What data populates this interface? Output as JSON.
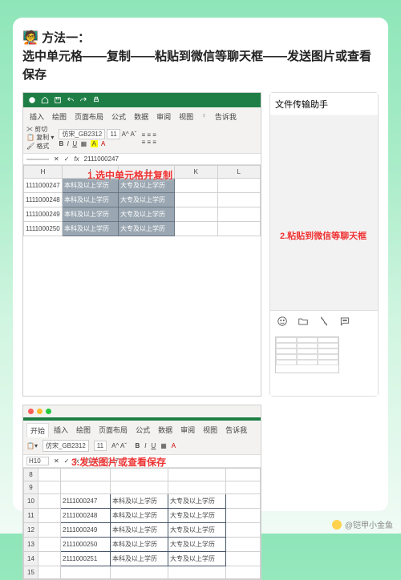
{
  "headline": {
    "emoji": "🧑‍🏫",
    "title": "方法一：",
    "body": "选中单元格——复制——粘贴到微信等聊天框——发送图片或查看保存"
  },
  "callouts": {
    "c1": "1.选中单元格并复制",
    "c2": "2.粘贴到微信等聊天框",
    "c3": "3.发送图片或查看保存"
  },
  "excel1": {
    "tabs": [
      "插入",
      "绘图",
      "页面布局",
      "公式",
      "数据",
      "审阅",
      "视图",
      "告诉我"
    ],
    "clipboard": {
      "cut": "剪切",
      "copy": "复制",
      "format": "格式"
    },
    "fontName": "仿宋_GB2312",
    "fontSize": "11",
    "formulaRef": "",
    "formulaVal": "2111000247",
    "cols": [
      "H",
      "I",
      "J",
      "K",
      "L"
    ],
    "rows": [
      {
        "a": "1111000247",
        "b": "本科及以上学历",
        "c": "大专及以上学历",
        "d": "",
        "e": ""
      },
      {
        "a": "1111000248",
        "b": "本科及以上学历",
        "c": "大专及以上学历",
        "d": "",
        "e": ""
      },
      {
        "a": "1111000249",
        "b": "本科及以上学历",
        "c": "大专及以上学历",
        "d": "",
        "e": ""
      },
      {
        "a": "1111000250",
        "b": "本科及以上学历",
        "c": "大专及以上学历",
        "d": "",
        "e": ""
      }
    ]
  },
  "wechat": {
    "title": "文件传输助手"
  },
  "excel2": {
    "tabs": [
      "开始",
      "插入",
      "绘图",
      "页面布局",
      "公式",
      "数据",
      "审阅",
      "视图",
      "告诉我"
    ],
    "fontName": "仿宋_GB2312",
    "fontSize": "11",
    "formulaRef": "H10",
    "formulaVal": "2111000247",
    "rowHeaders": [
      "8",
      "9",
      "10",
      "11",
      "12",
      "13",
      "14",
      "15"
    ],
    "rows": [
      {
        "a": "2111000247",
        "b": "本科及以上学历",
        "c": "大专及以上学历"
      },
      {
        "a": "2111000248",
        "b": "本科及以上学历",
        "c": "大专及以上学历"
      },
      {
        "a": "2111000249",
        "b": "本科及以上学历",
        "c": "大专及以上学历"
      },
      {
        "a": "2111000250",
        "b": "本科及以上学历",
        "c": "大专及以上学历"
      },
      {
        "a": "2111000251",
        "b": "本科及以上学历",
        "c": "大专及以上学历"
      }
    ]
  },
  "watermark": "@铠甲小金鱼"
}
